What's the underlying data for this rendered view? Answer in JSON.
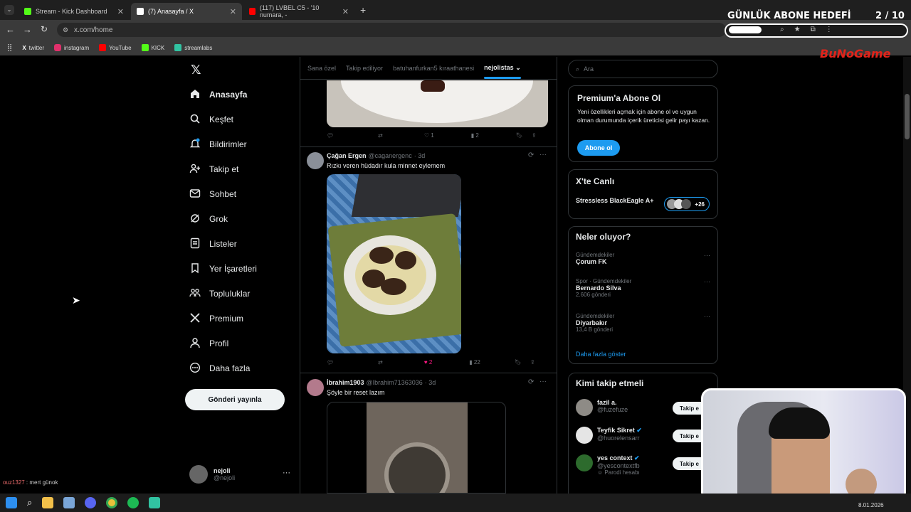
{
  "browser": {
    "tabs": [
      {
        "title": "Stream - Kick Dashboard",
        "icon": "kick-icon",
        "color": "#53fc18"
      },
      {
        "title": "(7) Anasayfa / X",
        "icon": "x-logo-icon",
        "color": "#ffffff"
      },
      {
        "title": "(117) LVBEL C5 - '10 numara, -",
        "icon": "youtube-icon",
        "color": "#ff0000"
      }
    ],
    "url": "x.com/home",
    "bookmarks": [
      "twitter",
      "instagram",
      "YouTube",
      "KICK",
      "streamlabs"
    ]
  },
  "overlay": {
    "goal_label": "GÜNLÜK ABONE HEDEFİ",
    "goal_count": "2  / 10",
    "goal_progress": 0.2,
    "brand": "BuNoGame",
    "chat_user": "ouz1327",
    "chat_message": " : mert günok",
    "date": "8.01.2026"
  },
  "nav": {
    "items": [
      {
        "label": "Anasayfa",
        "icon": "home-icon"
      },
      {
        "label": "Keşfet",
        "icon": "search-icon"
      },
      {
        "label": "Bildirimler",
        "icon": "bell-icon"
      },
      {
        "label": "Takip et",
        "icon": "follow-icon"
      },
      {
        "label": "Sohbet",
        "icon": "mail-icon"
      },
      {
        "label": "Grok",
        "icon": "grok-icon"
      },
      {
        "label": "Listeler",
        "icon": "list-icon"
      },
      {
        "label": "Yer İşaretleri",
        "icon": "bookmark-icon"
      },
      {
        "label": "Topluluklar",
        "icon": "communities-icon"
      },
      {
        "label": "Premium",
        "icon": "x-premium-icon"
      },
      {
        "label": "Profil",
        "icon": "profile-icon"
      },
      {
        "label": "Daha fazla",
        "icon": "more-circle-icon"
      }
    ],
    "post_button": "Gönderi yayınla",
    "account_name": "nejoli",
    "account_handle": "@nejoli"
  },
  "feed": {
    "tabs": [
      "Sana özel",
      "Takip ediliyor",
      "batuhanfurkan5 kıraathanesi",
      "nejolistas"
    ],
    "posts": [
      {
        "likes": "1",
        "views": "2"
      },
      {
        "name": "Çağan Ergen",
        "handle": "@caganergenc",
        "time": "· 3d",
        "text": "Rızkı veren hüdadır kula minnet eylemem",
        "likes": "2",
        "views": "22"
      },
      {
        "name": "İbrahim1903",
        "handle": "@Ibrahim71363036",
        "time": "· 3d",
        "text": "Şöyle bir reset lazım"
      }
    ]
  },
  "right": {
    "search_placeholder": "Ara",
    "premium": {
      "title": "Premium'a Abone Ol",
      "text": "Yeni özellikleri açmak için abone ol ve uygun olman durumunda içerik üreticisi gelir payı kazan.",
      "button": "Abone ol"
    },
    "live": {
      "title": "X'te Canlı",
      "host": "Stressless BlackEagle A+",
      "count": "+26"
    },
    "trends": {
      "title": "Neler oluyor?",
      "items": [
        {
          "context": "Gündemdekiler",
          "name": "Çorum FK",
          "posts": ""
        },
        {
          "context": "Spor · Gündemdekiler",
          "name": "Bernardo Silva",
          "posts": "2.606 gönderi"
        },
        {
          "context": "Gündemdekiler",
          "name": "Diyarbakır",
          "posts": "13,4 B gönderi"
        }
      ],
      "more": "Daha fazla göster"
    },
    "who_to_follow": {
      "title": "Kimi takip etmeli",
      "items": [
        {
          "name": "fazil a.",
          "handle": "@fuzefuze",
          "verified": false
        },
        {
          "name": "Teyfik Sikret",
          "handle": "@huorelensarr",
          "verified": true
        },
        {
          "name": "yes context",
          "handle": "@yescontextfb",
          "verified": true,
          "note": "Parodi hesabı"
        }
      ],
      "follow_label": "Takip e"
    }
  }
}
